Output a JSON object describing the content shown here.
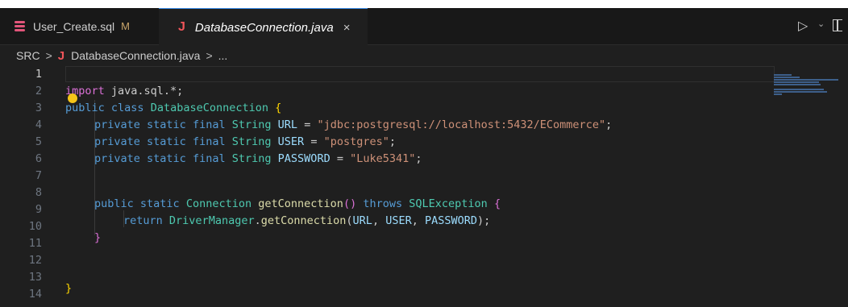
{
  "tabs": [
    {
      "label": "User_Create.sql",
      "badge": "M",
      "icon": "database-icon"
    },
    {
      "label": "DatabaseConnection.java",
      "icon": "java-file-icon",
      "close": "×"
    }
  ],
  "toolbar": {
    "run": "▷",
    "run_menu": "⌄",
    "split": "split-editor-icon"
  },
  "breadcrumb": {
    "root": "SRC",
    "sep1": ">",
    "java": "J",
    "file": "DatabaseConnection.java",
    "sep2": ">",
    "more": "..."
  },
  "editor": {
    "line_numbers": [
      "1",
      "2",
      "3",
      "4",
      "5",
      "6",
      "7",
      "8",
      "9",
      "10",
      "11",
      "12",
      "13",
      "14"
    ],
    "active_line": "1",
    "lines": {
      "l2": {
        "a": "import",
        "b": " java.sql.*;"
      },
      "l3": {
        "a": "public",
        "b": " ",
        "c": "class",
        "d": " ",
        "e": "DatabaseConnection",
        "f": " ",
        "g": "{"
      },
      "l4": {
        "a": "private",
        "b": "static",
        "c": "final",
        "d": "String",
        "e": "URL",
        "f": " = ",
        "g": "\"jdbc:postgresql://localhost:5432/ECommerce\"",
        "h": ";"
      },
      "l5": {
        "a": "private",
        "b": "static",
        "c": "final",
        "d": "String",
        "e": "USER",
        "f": " = ",
        "g": "\"postgres\"",
        "h": ";"
      },
      "l6": {
        "a": "private",
        "b": "static",
        "c": "final",
        "d": "String",
        "e": "PASSWORD",
        "f": " = ",
        "g": "\"Luke5341\"",
        "h": ";"
      },
      "l8": {
        "a": "public",
        "b": "static",
        "c": "Connection",
        "d": "getConnection",
        "e": "()",
        "f": "throws",
        "g": "SQLException",
        "h": "{"
      },
      "l9": {
        "a": "return",
        "b": "DriverManager",
        "c": ".",
        "d": "getConnection",
        "e": "(",
        "f": "URL",
        "g": ", ",
        "h": "USER",
        "i": ", ",
        "j": "PASSWORD",
        "k": ");"
      },
      "l10": {
        "a": "}"
      },
      "l13": {
        "a": "}"
      }
    }
  },
  "colors": {
    "background": "#1f1f1f",
    "keyword": "#569cd6",
    "type": "#4ec9b0",
    "function": "#dcdcaa",
    "string": "#ce9178",
    "variable": "#9cdcfe",
    "bracket1": "#ffd700",
    "bracket2": "#da70d6"
  }
}
